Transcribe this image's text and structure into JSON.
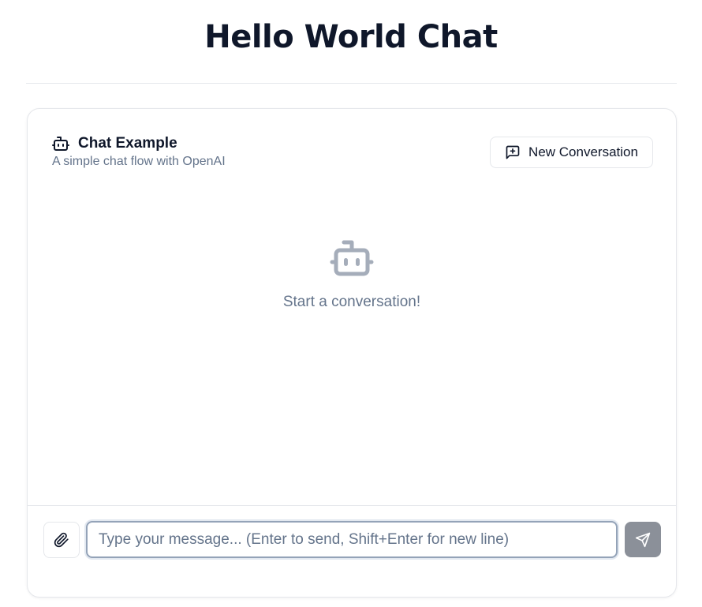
{
  "page": {
    "title": "Hello World Chat"
  },
  "chat": {
    "title": "Chat Example",
    "subtitle": "A simple chat flow with OpenAI",
    "title_icon": "bot-icon",
    "new_conversation": {
      "label": "New Conversation",
      "icon": "message-square-plus-icon"
    },
    "empty_state": {
      "icon": "bot-icon",
      "text": "Start a conversation!"
    },
    "composer": {
      "attach_icon": "paperclip-icon",
      "placeholder": "Type your message... (Enter to send, Shift+Enter for new line)",
      "value": "",
      "send_icon": "send-icon"
    }
  },
  "colors": {
    "title": "#0f172a",
    "muted": "#64748b",
    "border": "#e5e7eb",
    "send_button": "#8b9099",
    "icon_gray": "#a5adba"
  }
}
